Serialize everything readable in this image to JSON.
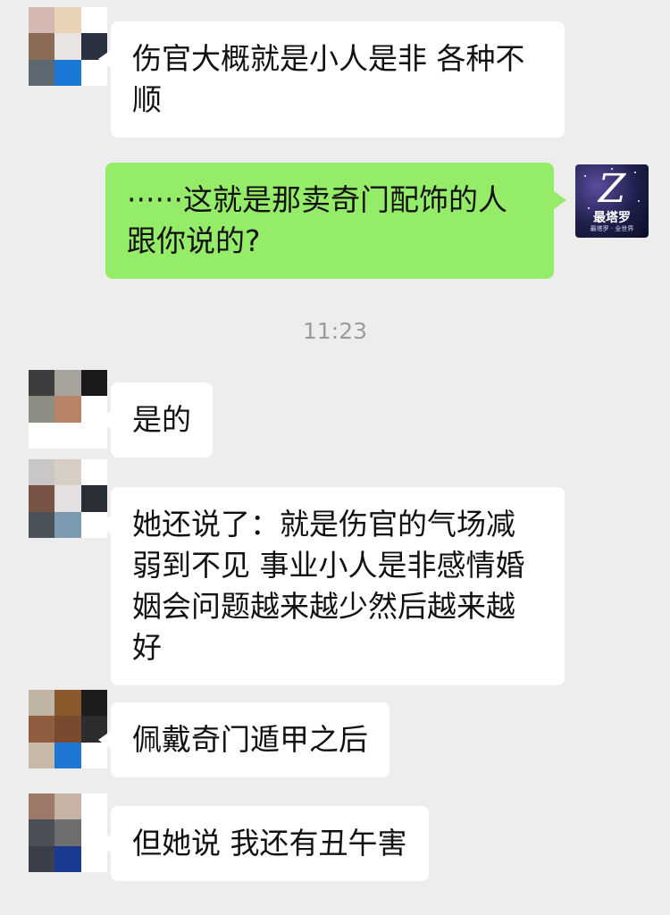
{
  "messages": [
    {
      "text": "伤官大概就是小人是非 各种不顺",
      "avatar_colors": [
        "#d4b9b2",
        "#e8d3b7",
        "#ffffff",
        "#8c6b57",
        "#e9e4e2",
        "#2a3140",
        "#5d6873",
        "#1778d6",
        "#ffffff"
      ]
    },
    {
      "text": "······这就是那卖奇门配饰的人跟你说的?"
    },
    {
      "text": "是的",
      "avatar_colors": [
        "#3d3d3d",
        "#a6a39c",
        "#1a1a1a",
        "#8d8d83",
        "#b88468",
        "#ffffff",
        "#ffffff",
        "#ffffff",
        "#ffffff"
      ]
    },
    {
      "text": "她还说了：就是伤官的气场减弱到不见 事业小人是非感情婚姻会问题越来越少然后越来越好",
      "avatar_colors": [
        "#c9c6c6",
        "#d8cfc4",
        "#ffffff",
        "#7a5347",
        "#e4e0e1",
        "#2a2e35",
        "#4a5159",
        "#7d9bb0",
        "#ffffff"
      ]
    },
    {
      "text": "佩戴奇门遁甲之后",
      "avatar_colors": [
        "#c0b4a4",
        "#8a5a2c",
        "#1c1c1c",
        "#8f5d3f",
        "#7a4a2f",
        "#2d2d2d",
        "#c8b9a8",
        "#1e77d4",
        "#ffffff"
      ]
    },
    {
      "text": "但她说 我还有丑午害",
      "avatar_colors": [
        "#9c7868",
        "#c6b3a6",
        "#ffffff",
        "#4b4f57",
        "#6f6d6d",
        "#ffffff",
        "#3a3f4a",
        "#1a3a8f",
        "#ffffff"
      ]
    }
  ],
  "timestamp": "11:23",
  "self_avatar": {
    "monogram": "Z",
    "brand": "最塔罗",
    "tagline": "最塔罗 · 全世界"
  },
  "colors": {
    "background": "#ededed",
    "incoming_bubble": "#ffffff",
    "outgoing_bubble": "#95ec69",
    "timestamp": "#9b9b9b"
  }
}
